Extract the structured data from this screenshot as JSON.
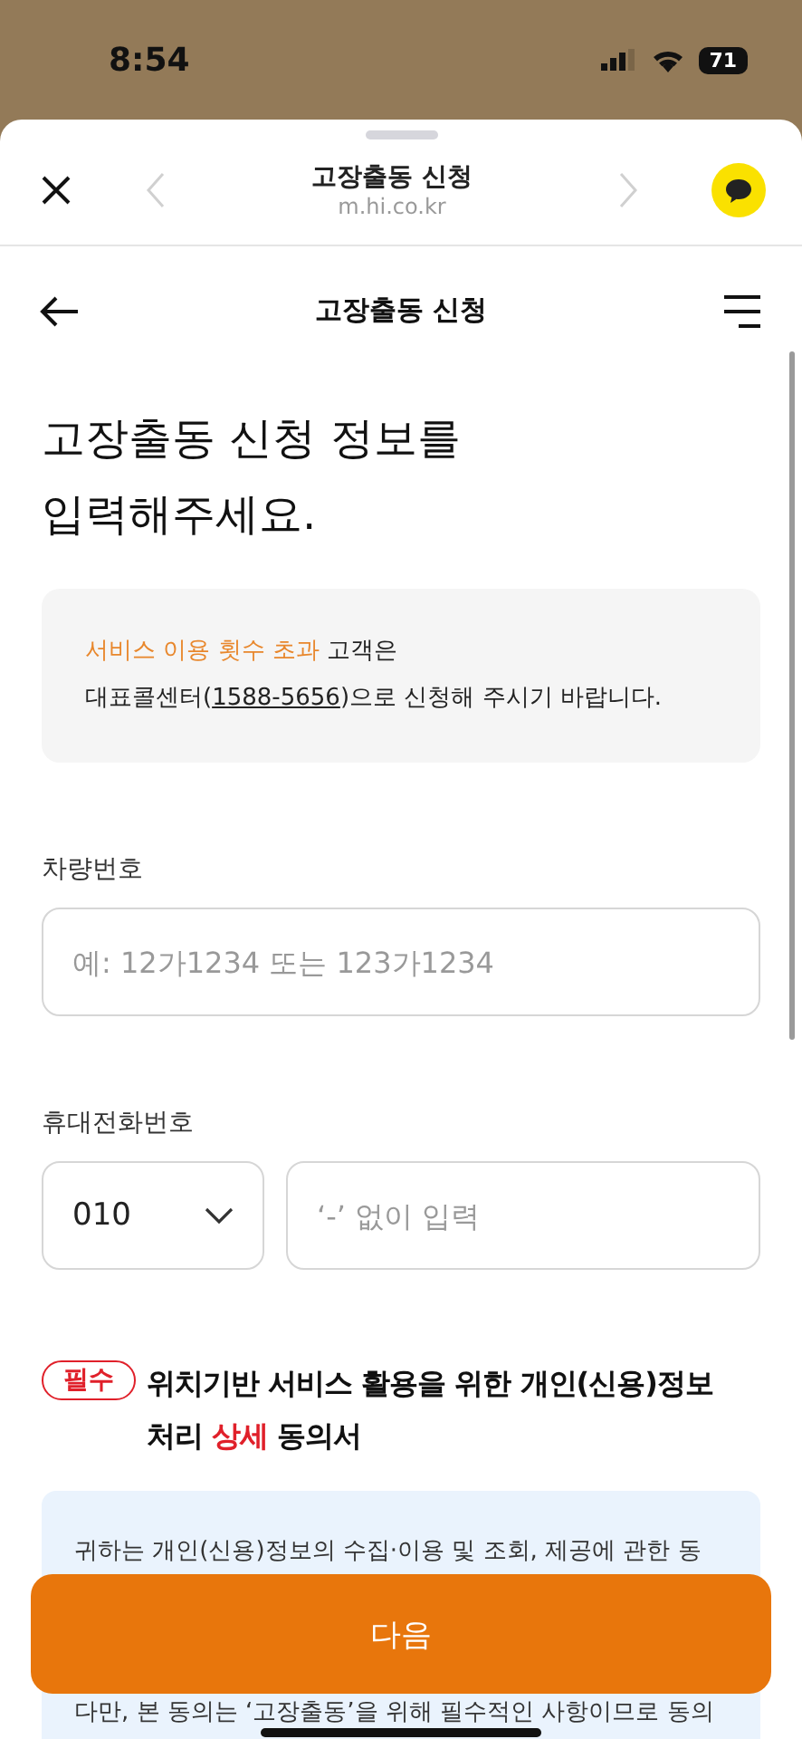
{
  "status_bar": {
    "time": "8:54",
    "battery": "71"
  },
  "browser_bar": {
    "title": "고장출동 신청",
    "url": "m.hi.co.kr",
    "back_enabled": false,
    "forward_enabled": false
  },
  "page_header": {
    "title": "고장출동 신청"
  },
  "heading": "고장출동 신청 정보를\n입력해주세요.",
  "notice": {
    "lines": [
      [
        {
          "kind": "highlight",
          "text": "서비스 이용 횟수 초과"
        },
        {
          "kind": "plain",
          "text": " 고객은"
        }
      ],
      [
        {
          "kind": "plain",
          "text": "대표콜센터("
        },
        {
          "kind": "link",
          "text": "1588-5656"
        },
        {
          "kind": "plain",
          "text": ")으로 신청해 주시기 바랍니다."
        }
      ]
    ]
  },
  "fields": [
    {
      "kind": "text",
      "label": "차량번호",
      "placeholder": "예: 12가1234 또는 123가1234"
    },
    {
      "kind": "phone",
      "label": "휴대전화번호",
      "prefix": "010",
      "placeholder": "‘-’ 없이 입력"
    }
  ],
  "consent": {
    "badge": "필수",
    "title": [
      {
        "kind": "plain",
        "text": "위치기반 서비스 활용을 위한 개인(신용)정보 처리 "
      },
      {
        "kind": "accent",
        "text": "상세"
      },
      {
        "kind": "plain",
        "text": " 동의서"
      }
    ],
    "paragraphs": [
      "귀하는 개인(신용)정보의 수집·이용 및 조회, 제공에 관한 동",
      "다만, 본 동의는 ‘고장출동’을 위해 필수적인 사항이므로 동의"
    ]
  },
  "next_button": "다음"
}
